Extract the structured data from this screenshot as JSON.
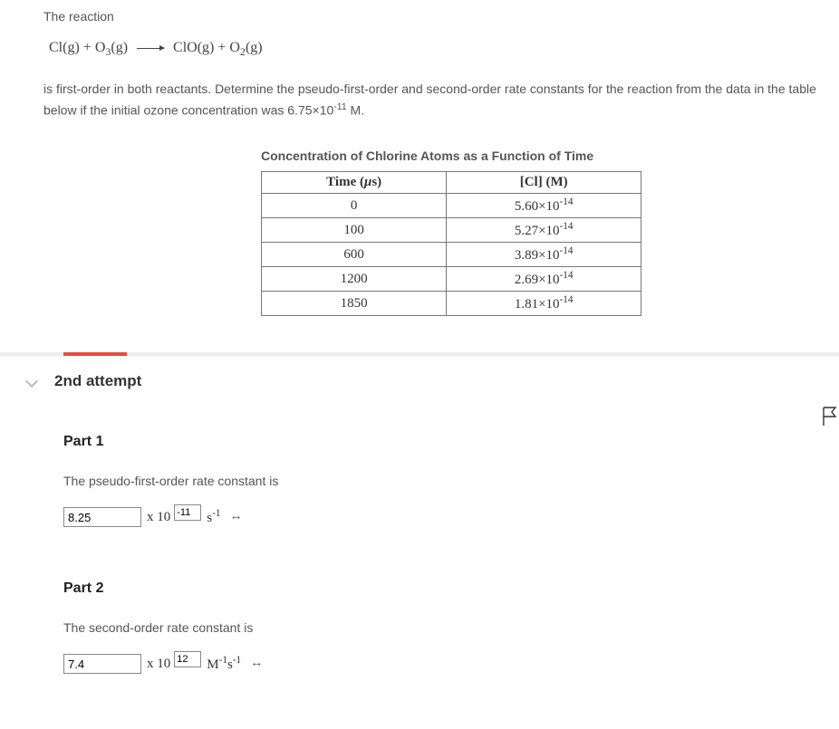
{
  "intro": {
    "lead": "The reaction",
    "equation": {
      "lhs1": "Cl(g)",
      "lhs2": "O",
      "lhs2_sub": "3",
      "lhs2_tail": "(g)",
      "rhs1": "ClO(g)",
      "rhs2": "O",
      "rhs2_sub": "2",
      "rhs2_tail": "(g)"
    },
    "desc1": "is first-order in both reactants. Determine the pseudo-first-order and second-order rate constants for the reaction from the data in the table below if the initial ozone concentration was 6.75×10",
    "desc1_exp": "-11",
    "desc1_tail": " M."
  },
  "table": {
    "title": "Concentration of Chlorine Atoms as a Function of Time",
    "head_time_pre": "Time (",
    "head_time_unit": "μ",
    "head_time_post": "s)",
    "head_cl": "[Cl] (M)",
    "rows": [
      {
        "time": "0",
        "conc_base": "5.60×10",
        "conc_exp": "-14"
      },
      {
        "time": "100",
        "conc_base": "5.27×10",
        "conc_exp": "-14"
      },
      {
        "time": "600",
        "conc_base": "3.89×10",
        "conc_exp": "-14"
      },
      {
        "time": "1200",
        "conc_base": "2.69×10",
        "conc_exp": "-14"
      },
      {
        "time": "1850",
        "conc_base": "1.81×10",
        "conc_exp": "-14"
      }
    ]
  },
  "attempt": {
    "label": "2nd attempt"
  },
  "part1": {
    "heading": "Part 1",
    "text": "The pseudo-first-order rate constant is",
    "value": "8.25",
    "exp": "-11",
    "x10": "x 10",
    "unit_pre": "s",
    "unit_exp": "-1",
    "arrow": "↔"
  },
  "part2": {
    "heading": "Part 2",
    "text": "The second-order rate constant is",
    "value": "7.4",
    "exp": "12",
    "x10": "x 10",
    "unit_m": "M",
    "unit_m_exp": "-1",
    "unit_s": "s",
    "unit_s_exp": "-1",
    "arrow": "↔"
  }
}
